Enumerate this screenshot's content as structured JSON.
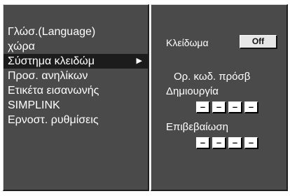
{
  "menu": {
    "items": [
      {
        "label": "Γλώσ.(Language)"
      },
      {
        "label": "χώρα"
      },
      {
        "label": "Σύστημα κλειδώμ",
        "arrow": "▶"
      },
      {
        "label": "Προσ. ανηλίκων"
      },
      {
        "label": "Ετικέτα εισανωνής"
      },
      {
        "label": "SIMPLINK"
      },
      {
        "label": "Ερνοστ. ρυθμίσεις"
      }
    ]
  },
  "lock_panel": {
    "lock_label": "Κλείδωμα",
    "lock_value": "Off",
    "password_caption": "Ορ. κωδ. πρόσβ",
    "create_label": "Δημιουργία",
    "create_digits": [
      "–",
      "–",
      "–",
      "–"
    ],
    "confirm_label": "Επιβεβαίωση",
    "confirm_digits": [
      "–",
      "–",
      "–",
      "–"
    ]
  },
  "colors": {
    "panel": "#4a4a4a",
    "selected_row": "#1c1c1c",
    "text": "#ffffff"
  }
}
